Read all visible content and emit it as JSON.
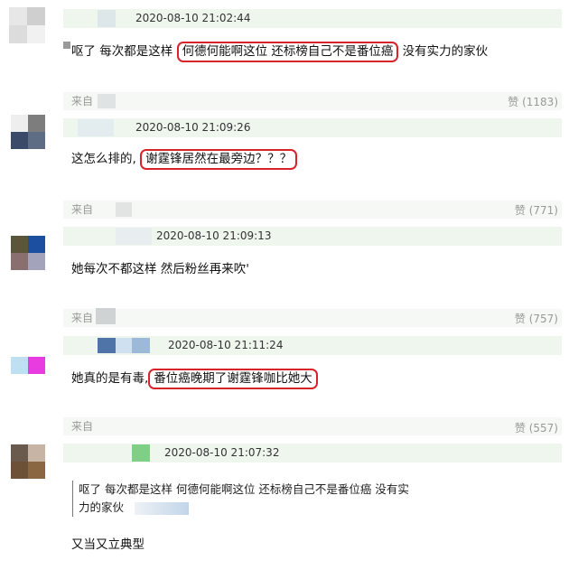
{
  "comments": [
    {
      "timestamp": "2020-08-10 21:02:44",
      "text_before": "呕了 每次都是这样 ",
      "text_highlight": "何德何能啊这位 还标榜自己不是番位癌",
      "text_after": " 没有实力的家伙"
    },
    {
      "from_label": "来自",
      "likes": "赞 (1183)",
      "timestamp": "2020-08-10 21:09:26",
      "text_before": "这怎么排的, ",
      "text_highlight": "谢霆锋居然在最旁边？？？",
      "text_after": ""
    },
    {
      "from_label": "来自",
      "likes": "赞 (771)",
      "timestamp": "2020-08-10 21:09:13",
      "text_before": "她每次不都这样 然后粉丝再来吹'",
      "text_highlight": "",
      "text_after": ""
    },
    {
      "from_label": "来自",
      "likes": "赞 (757)",
      "timestamp": "2020-08-10 21:11:24",
      "text_before": "她真的是有毒,",
      "text_highlight": "番位癌晚期了谢霆锋咖比她大",
      "text_after": ""
    },
    {
      "from_label": "来自",
      "likes": "赞 (557)",
      "timestamp": "2020-08-10 21:07:32",
      "quote_line1": "呕了 每次都是这样 何德何能啊这位 还标榜自己不是番位癌 没有实",
      "quote_line2": "力的家伙",
      "text_before": "又当又立典型",
      "text_highlight": "",
      "text_after": ""
    }
  ],
  "colors": {
    "highlight_border": "#d8232a",
    "header_bar": "#eef6ee",
    "meta_text": "#999999"
  }
}
